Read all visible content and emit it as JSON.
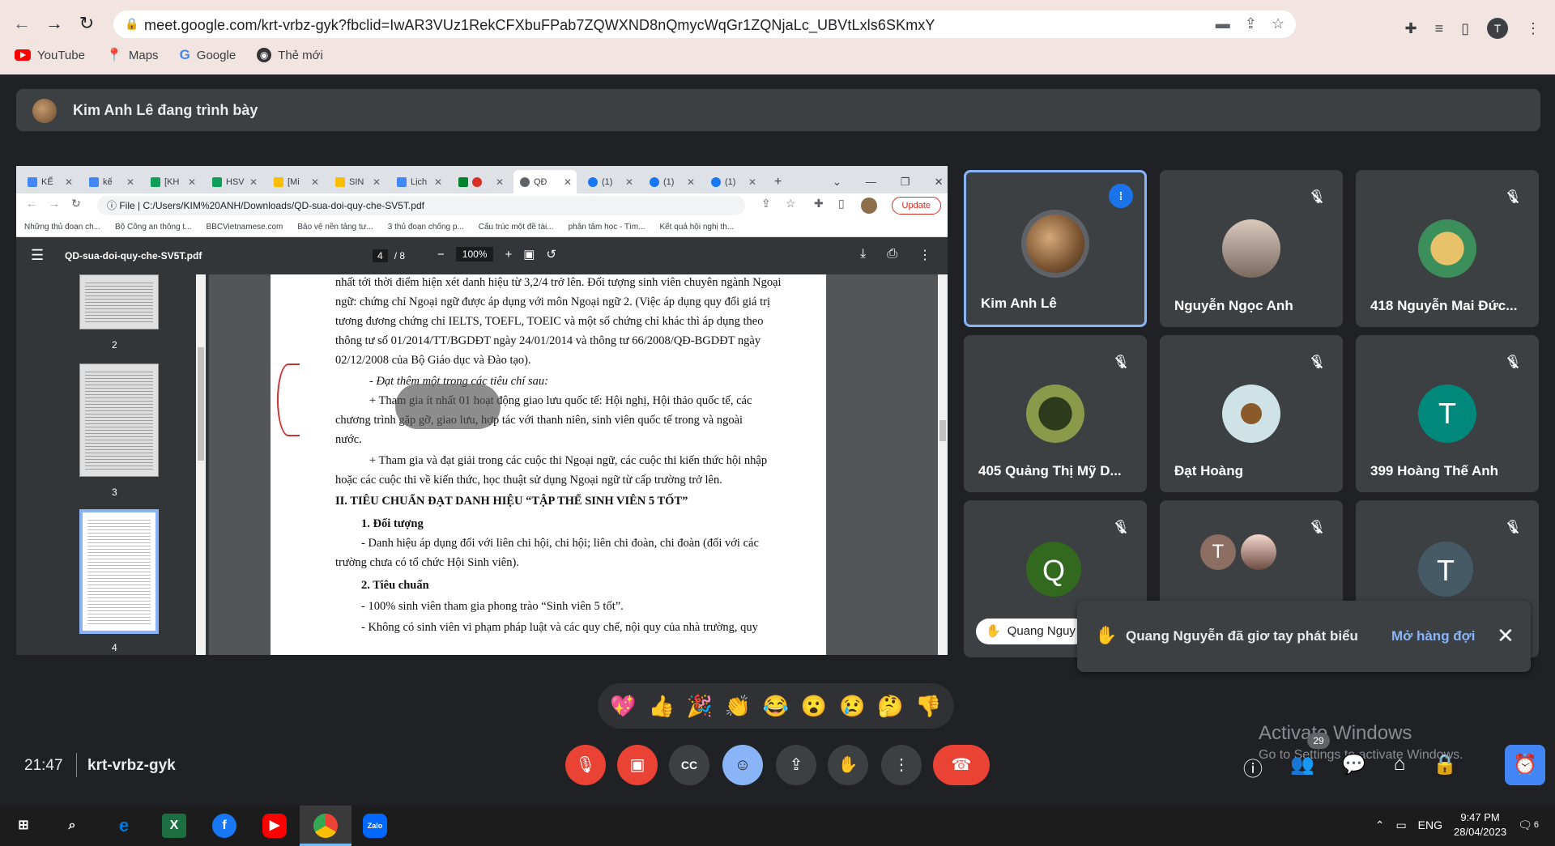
{
  "browser": {
    "url": "meet.google.com/krt-vrbz-gyk?fbclid=IwAR3VUz1RekCFXbuFPab7ZQWXND8nQmycWqGr1ZQNjaLc_UBVtLxls6SKmxY",
    "profile_initial": "T",
    "bookmarks": [
      "YouTube",
      "Maps",
      "Google",
      "Thẻ mới"
    ]
  },
  "presenting_banner": "Kim Anh Lê đang trình bày",
  "shared": {
    "tabs": [
      "KẾ",
      "kế",
      "[KH",
      "HSV",
      "[Mi",
      "SIN",
      "Lịch",
      "",
      "QĐ",
      "(1)",
      "(1)",
      "(1)"
    ],
    "file_label": "File",
    "path": "C:/Users/KIM%20ANH/Downloads/QD-sua-doi-quy-che-SV5T.pdf",
    "update_label": "Update",
    "bookmarks": [
      "Những thủ đoạn ch...",
      "Bộ Công an thông t...",
      "BBCVietnamese.com",
      "Bảo vệ nền tảng tư...",
      "3 thủ đoạn chống p...",
      "Cấu trúc một đề tài...",
      "phân tâm học - Tìm...",
      "Kết quả hội nghị th..."
    ],
    "pdf_name": "QD-sua-doi-quy-che-SV5T.pdf",
    "page_current": "4",
    "page_total": "/ 8",
    "zoom": "100%",
    "thumb_labels": [
      "2",
      "3",
      "4"
    ],
    "lines": [
      "nhất tới thời điểm hiện xét danh hiệu từ 3,2/4 trở lên. Đối tượng sinh viên chuyên ngành Ngoại",
      "ngữ: chứng chỉ Ngoại ngữ được áp dụng với môn Ngoại ngữ 2. (Việc áp dụng quy đổi giá trị",
      "tương đương chứng chỉ IELTS, TOEFL, TOEIC và một số chứng chỉ khác thì áp dụng theo",
      "thông tư số 01/2014/TT/BGDĐT ngày 24/01/2014 và thông tư 66/2008/QĐ-BGDĐT ngày",
      "02/12/2008 của Bộ Giáo dục và Đào tạo).",
      "- Đạt thêm một trong các tiêu chí sau:",
      "+ Tham gia ít nhất 01 hoạt động giao lưu quốc tế: Hội nghị, Hội thảo quốc tế, các",
      "chương trình gặp gỡ, giao lưu, hợp tác với thanh niên, sinh viên quốc tế trong và ngoài",
      "nước.",
      "+ Tham gia và đạt giải trong các cuộc thi Ngoại ngữ, các cuộc thi kiến thức hội nhập",
      "hoặc các cuộc thi về kiến thức, học thuật sử dụng Ngoại ngữ từ cấp trường trở lên.",
      "II. TIÊU CHUẨN ĐẠT DANH HIỆU “TẬP THỂ SINH VIÊN 5 TỐT”",
      "1. Đối tượng",
      "- Danh hiệu áp dụng đối với liên chi hội, chi hội; liên chi đoàn, chi đoàn (đối với các",
      "trường chưa có tổ chức Hội Sinh viên).",
      "2. Tiêu chuẩn",
      "- 100% sinh viên tham gia phong trào “Sinh viên 5 tốt”.",
      "- Không có sinh viên vi phạm pháp luật và các quy chế, nội quy của nhà trường, quy"
    ]
  },
  "participants": [
    {
      "name": "Kim Anh Lê",
      "initial": ""
    },
    {
      "name": "Nguyễn Ngọc Anh",
      "initial": ""
    },
    {
      "name": "418 Nguyễn Mai Đức...",
      "initial": ""
    },
    {
      "name": "405 Quảng Thị Mỹ D...",
      "initial": ""
    },
    {
      "name": "Đạt Hoàng",
      "initial": ""
    },
    {
      "name": "399 Hoàng Thế Anh",
      "initial": "T"
    },
    {
      "name": "",
      "initial": "Q"
    },
    {
      "name": "",
      "initial": "T"
    },
    {
      "name": "",
      "initial": "T"
    }
  ],
  "name_chip": "Quang Nguy",
  "notification": {
    "text": "Quang Nguyễn đã giơ tay phát biểu",
    "action": "Mở hàng đợi"
  },
  "reactions": [
    "💖",
    "👍",
    "🎉",
    "👏",
    "😂",
    "😮",
    "😢",
    "🤔",
    "👎"
  ],
  "meeting": {
    "time": "21:47",
    "code": "krt-vrbz-gyk"
  },
  "people_count": "29",
  "watermark": {
    "line1": "Activate Windows",
    "line2": "Go to Settings to activate Windows."
  },
  "taskbar": {
    "lang": "ENG",
    "time": "9:47 PM",
    "date": "28/04/2023",
    "notif_count": "6"
  },
  "colors": {
    "end_call": "#ea4335",
    "accent": "#8ab4f8",
    "alarm": "#4285f4"
  }
}
